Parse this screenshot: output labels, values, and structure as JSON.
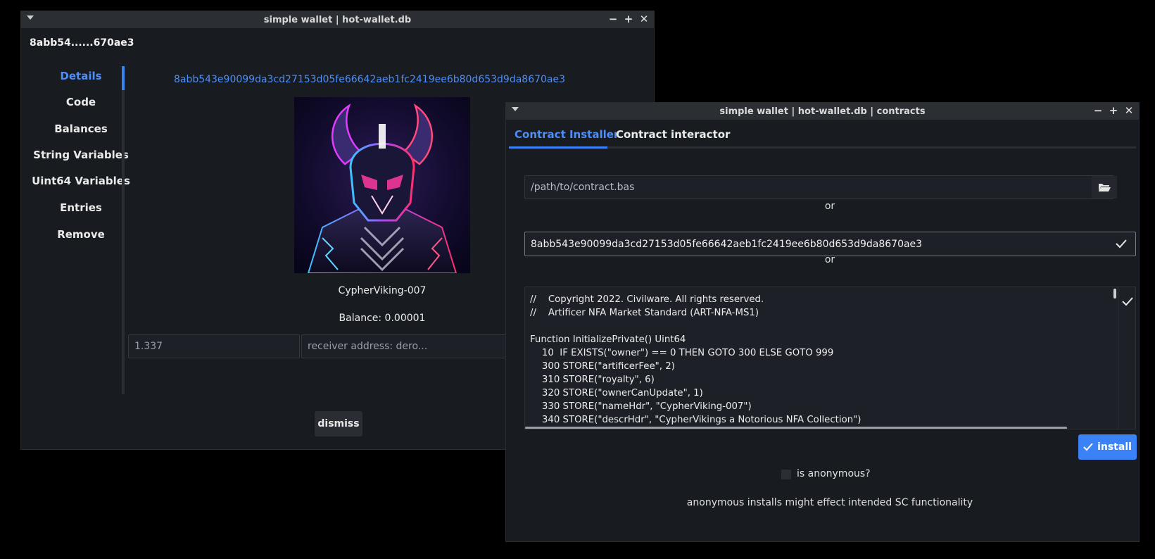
{
  "colors": {
    "accent": "#3b82f6",
    "link": "#4d8ef8",
    "bg": "#181b20",
    "titlebar": "#2b2e33"
  },
  "window_main": {
    "title": "simple wallet | hot-wallet.db",
    "short_id": "8abb54......670ae3",
    "sidebar": {
      "items": [
        {
          "label": "Details",
          "active": true
        },
        {
          "label": "Code"
        },
        {
          "label": "Balances"
        },
        {
          "label": "String Variables"
        },
        {
          "label": "Uint64 Variables"
        },
        {
          "label": "Entries"
        },
        {
          "label": "Remove"
        }
      ]
    },
    "details": {
      "scid": "8abb543e90099da3cd27153d05fe66642aeb1fc2419ee6b80d653d9da8670ae3",
      "nft_name": "CypherViking-007",
      "balance": "Balance: 0.00001",
      "amount_value": "1.337",
      "receiver_placeholder": "receiver address: dero...",
      "dismiss_label": "dismiss"
    }
  },
  "window_contracts": {
    "title": "simple wallet | hot-wallet.db | contracts",
    "tabs": [
      {
        "label": "Contract Installer",
        "active": true
      },
      {
        "label": "Contract interactor"
      }
    ],
    "installer": {
      "path_placeholder": "/path/to/contract.bas",
      "or_label": "or",
      "scid_value": "8abb543e90099da3cd27153d05fe66642aeb1fc2419ee6b80d653d9da8670ae3",
      "code_lines": [
        "//    Copyright 2022. Civilware. All rights reserved.",
        "//    Artificer NFA Market Standard (ART-NFA-MS1)",
        "",
        "Function InitializePrivate() Uint64",
        "    10  IF EXISTS(\"owner\") == 0 THEN GOTO 300 ELSE GOTO 999",
        "    300 STORE(\"artificerFee\", 2)",
        "    310 STORE(\"royalty\", 6)",
        "    320 STORE(\"ownerCanUpdate\", 1)",
        "    330 STORE(\"nameHdr\", \"CypherViking-007\")",
        "    340 STORE(\"descrHdr\", \"CypherVikings a Notorious NFA Collection\")"
      ],
      "install_label": "install",
      "anonymous_label": "is anonymous?",
      "anonymous_checked": false,
      "anonymous_note": "anonymous installs might effect intended SC functionality"
    }
  },
  "icons": {
    "window_controls": [
      "minimize-icon",
      "maximize-icon",
      "close-icon"
    ],
    "folder": "folder-open-icon",
    "check": "checkmark-icon"
  }
}
